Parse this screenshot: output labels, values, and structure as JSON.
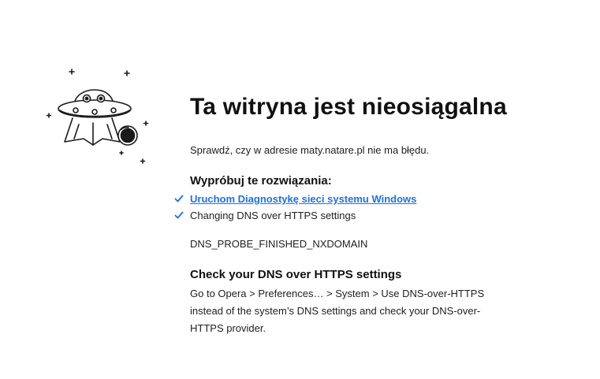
{
  "title": "Ta witryna jest nieosiągalna",
  "check_url_text": "Sprawdź, czy w adresie maty.natare.pl nie ma błędu.",
  "try_heading": "Wypróbuj te rozwiązania:",
  "suggestions": [
    {
      "label": "Uruchom Diagnostykę sieci systemu Windows",
      "is_link": true
    },
    {
      "label": "Changing DNS over HTTPS settings",
      "is_link": false
    }
  ],
  "error_code": "DNS_PROBE_FINISHED_NXDOMAIN",
  "dns_section": {
    "heading": "Check your DNS over HTTPS settings",
    "body": "Go to Opera > Preferences… > System > Use DNS-over-HTTPS instead of the system’s DNS settings and check your DNS-over-HTTPS provider."
  },
  "icons": {
    "illustration": "ufo-illustration",
    "check": "check-icon"
  },
  "colors": {
    "link": "#1a73e8",
    "check": "#1a73e8",
    "text": "#202124"
  }
}
